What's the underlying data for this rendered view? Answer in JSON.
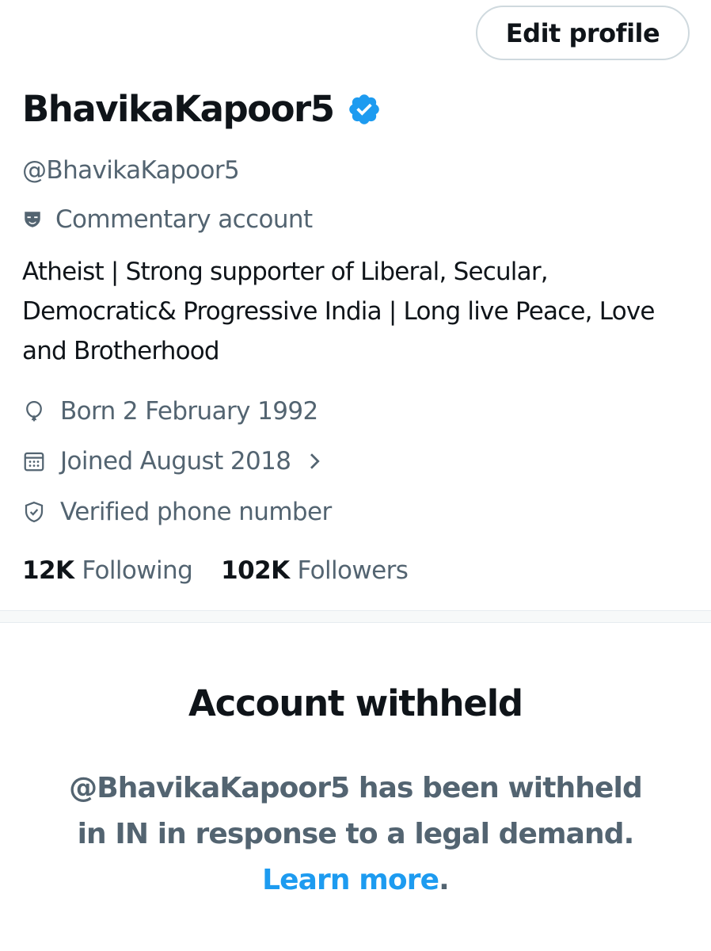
{
  "header": {
    "edit_profile_label": "Edit profile"
  },
  "profile": {
    "display_name": "BhavikaKapoor5",
    "handle": "@BhavikaKapoor5",
    "account_label": "Commentary account",
    "bio": "Atheist | Strong supporter of Liberal, Secular, Democratic& Progressive India | Long live Peace, Love and Brotherhood",
    "born": "Born 2 February 1992",
    "joined": "Joined August 2018",
    "verified_phone": "Verified phone number",
    "verified_badge_color": "#1d9bf0"
  },
  "stats": {
    "following_count": "12K",
    "following_label": "Following",
    "followers_count": "102K",
    "followers_label": "Followers"
  },
  "withheld": {
    "title": "Account withheld",
    "line1": "@BhavikaKapoor5 has been withheld",
    "line2": "in IN in response to a legal demand.",
    "learn_more": "Learn more",
    "period": "."
  },
  "colors": {
    "text_primary": "#0f1419",
    "text_secondary": "#536471",
    "link": "#1d9bf0",
    "border": "#cfd9de"
  }
}
